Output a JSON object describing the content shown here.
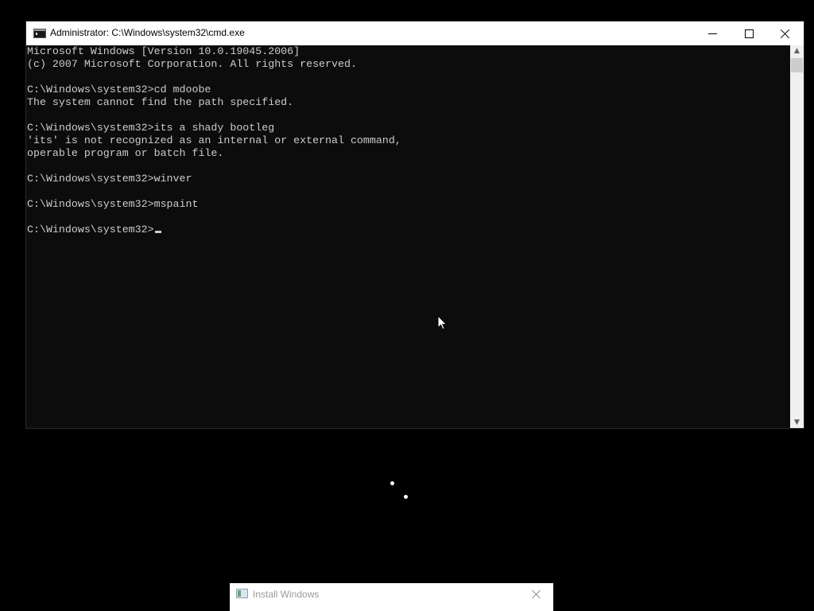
{
  "cmd_window": {
    "title": "Administrator: C:\\Windows\\system32\\cmd.exe",
    "icon": "cmd-icon",
    "controls": {
      "minimize": "minimize-icon",
      "maximize": "maximize-icon",
      "close": "close-icon"
    },
    "console_lines": [
      "Microsoft Windows [Version 10.0.19045.2006]",
      "(c) 2007 Microsoft Corporation. All rights reserved.",
      "",
      "C:\\Windows\\system32>cd mdoobe",
      "The system cannot find the path specified.",
      "",
      "C:\\Windows\\system32>its a shady bootleg",
      "'its' is not recognized as an internal or external command,",
      "operable program or batch file.",
      "",
      "C:\\Windows\\system32>winver",
      "",
      "C:\\Windows\\system32>mspaint",
      ""
    ],
    "prompt": "C:\\Windows\\system32>",
    "colors": {
      "console_bg": "#0c0c0c",
      "console_text": "#cccccc",
      "titlebar_bg": "#ffffff"
    }
  },
  "install_window": {
    "title": "Install Windows",
    "icon": "setup-icon",
    "close": "close-icon"
  },
  "desktop": {
    "background": "#000000",
    "spinner": "loading-spinner-icon"
  }
}
